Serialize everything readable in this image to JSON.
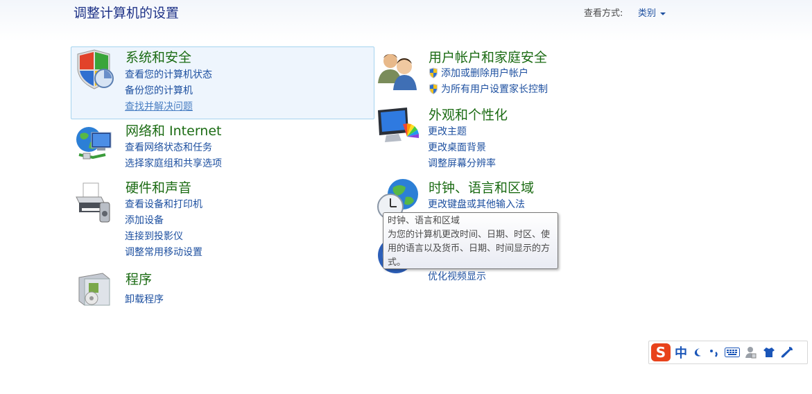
{
  "header": {
    "title": "调整计算机的设置",
    "view_by_label": "查看方式:",
    "view_by_value": "类别"
  },
  "categories": {
    "system_security": {
      "title": "系统和安全",
      "links": [
        "查看您的计算机状态",
        "备份您的计算机",
        "查找并解决问题"
      ]
    },
    "network": {
      "title": "网络和 Internet",
      "links": [
        "查看网络状态和任务",
        "选择家庭组和共享选项"
      ]
    },
    "hardware": {
      "title": "硬件和声音",
      "links": [
        "查看设备和打印机",
        "添加设备",
        "连接到投影仪",
        "调整常用移动设置"
      ]
    },
    "programs": {
      "title": "程序",
      "links": [
        "卸载程序"
      ]
    },
    "user_accounts": {
      "title": "用户帐户和家庭安全",
      "links": [
        "添加或删除用户帐户",
        "为所有用户设置家长控制"
      ]
    },
    "appearance": {
      "title": "外观和个性化",
      "links": [
        "更改主题",
        "更改桌面背景",
        "调整屏幕分辨率"
      ]
    },
    "clock": {
      "title": "时钟、语言和区域",
      "links": [
        "更改键盘或其他输入法"
      ]
    },
    "ease_of_access": {
      "links": [
        "优化视频显示"
      ]
    }
  },
  "tooltip": {
    "title": "时钟、语言和区域",
    "body": "为您的计算机更改时间、日期、时区、使用的语言以及货币、日期、时间显示的方式。"
  },
  "ime_toolbar": {
    "logo": "S",
    "mode": "中",
    "icons": [
      "sogou-logo-icon",
      "chinese-mode-icon",
      "moon-icon",
      "punctuation-icon",
      "keyboard-icon",
      "user-icon",
      "skin-icon",
      "wrench-icon"
    ]
  },
  "colors": {
    "title_blue": "#1e3287",
    "link_blue": "#1e50a0",
    "category_green": "#1b6b13"
  }
}
